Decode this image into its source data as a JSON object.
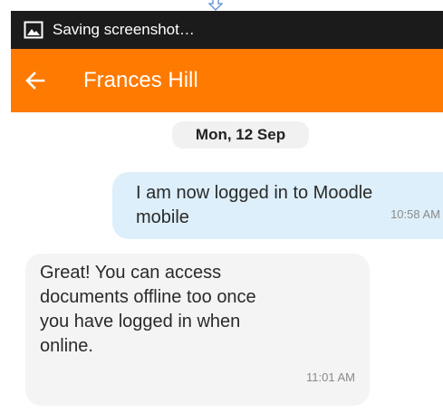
{
  "status_bar": {
    "icon": "image-icon",
    "text": "Saving screenshot…"
  },
  "toolbar": {
    "back_icon": "back-arrow-icon",
    "title": "Frances Hill",
    "color": "#ff7a00"
  },
  "conversation": {
    "date": "Mon, 12 Sep",
    "messages": [
      {
        "direction": "sent",
        "text": "I am now logged in to Moodle\nmobile",
        "time": "10:58 AM"
      },
      {
        "direction": "received",
        "text": "Great! You can access\ndocuments offline too once\nyou have logged in when\nonline.",
        "time": "11:01 AM"
      }
    ]
  }
}
